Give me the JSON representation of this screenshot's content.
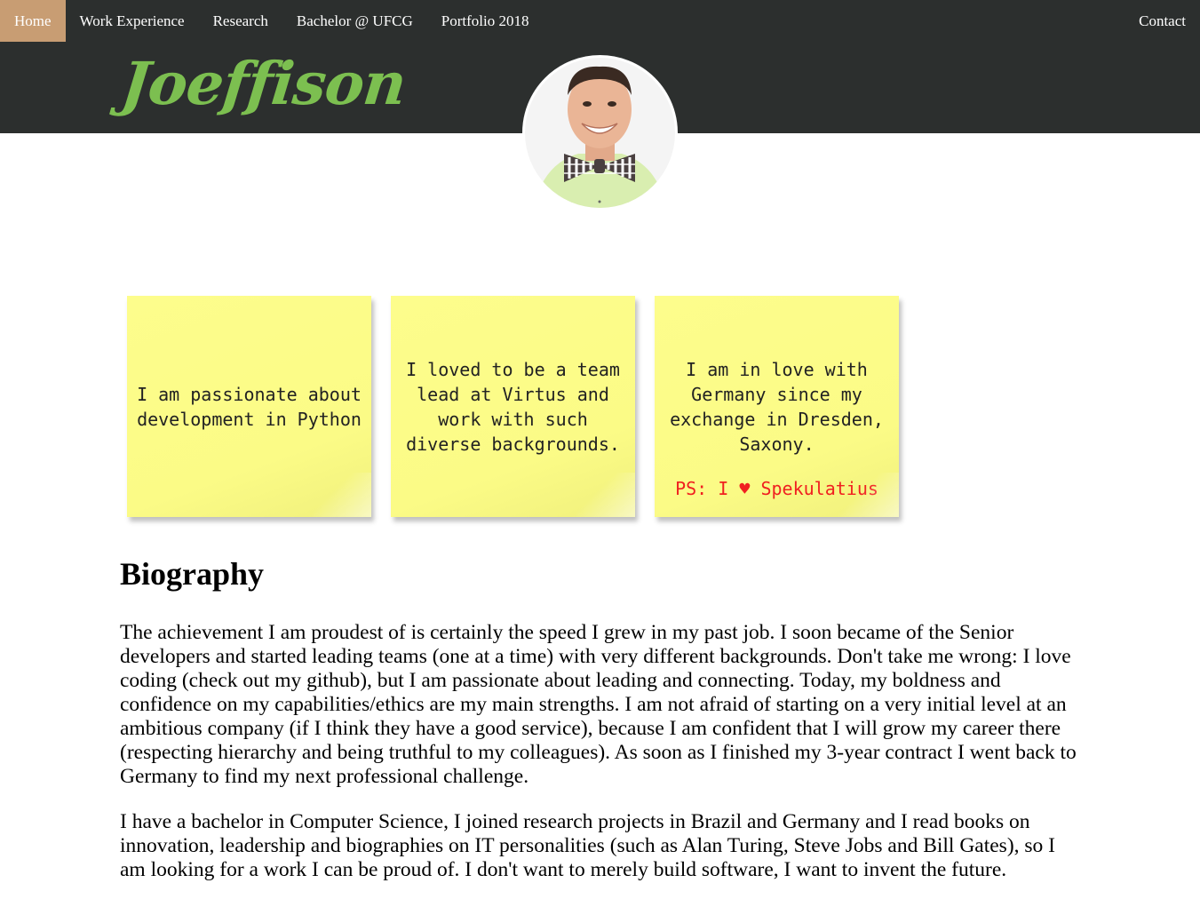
{
  "nav": {
    "items": [
      {
        "label": "Home",
        "active": true
      },
      {
        "label": "Work Experience",
        "active": false
      },
      {
        "label": "Research",
        "active": false
      },
      {
        "label": "Bachelor @ UFCG",
        "active": false
      },
      {
        "label": "Portfolio 2018",
        "active": false
      }
    ],
    "contact_label": "Contact"
  },
  "header": {
    "brand": "Joeffison"
  },
  "notes": [
    {
      "text": "I am passionate about development in Python"
    },
    {
      "text": "I loved to be a team lead at Virtus and work with such diverse backgrounds."
    },
    {
      "text": "I am in love with Germany since my exchange in Dresden, Saxony.",
      "ps_prefix": "PS: I",
      "ps_heart": "♥",
      "ps_suffix": "Spekulatius"
    }
  ],
  "biography": {
    "title": "Biography",
    "paragraphs": [
      "The achievement I am proudest of is certainly the speed I grew in my past job. I soon became of the Senior developers and started leading teams (one at a time) with very different backgrounds. Don't take me wrong: I love coding (check out my github), but I am passionate about leading and connecting. Today, my boldness and confidence on my capabilities/ethics are my main strengths. I am not afraid of starting on a very initial level at an ambitious company (if I think they have a good service), because I am confident that I will grow my career there (respecting hierarchy and being truthful to my colleagues). As soon as I finished my 3-year contract I went back to Germany to find my next professional challenge.",
      "I have a bachelor in Computer Science, I joined research projects in Brazil and Germany and I read books on innovation, leadership and biographies on IT personalities (such as Alan Turing, Steve Jobs and Bill Gates), so I am looking for a work I can be proud of. I don't want to merely build software, I want to invent the future."
    ]
  },
  "colors": {
    "nav_bg": "#2c2f2e",
    "nav_active": "#c89d73",
    "brand": "#7cbf50",
    "note": "#fdfd8c",
    "ps_text": "#f02020"
  }
}
